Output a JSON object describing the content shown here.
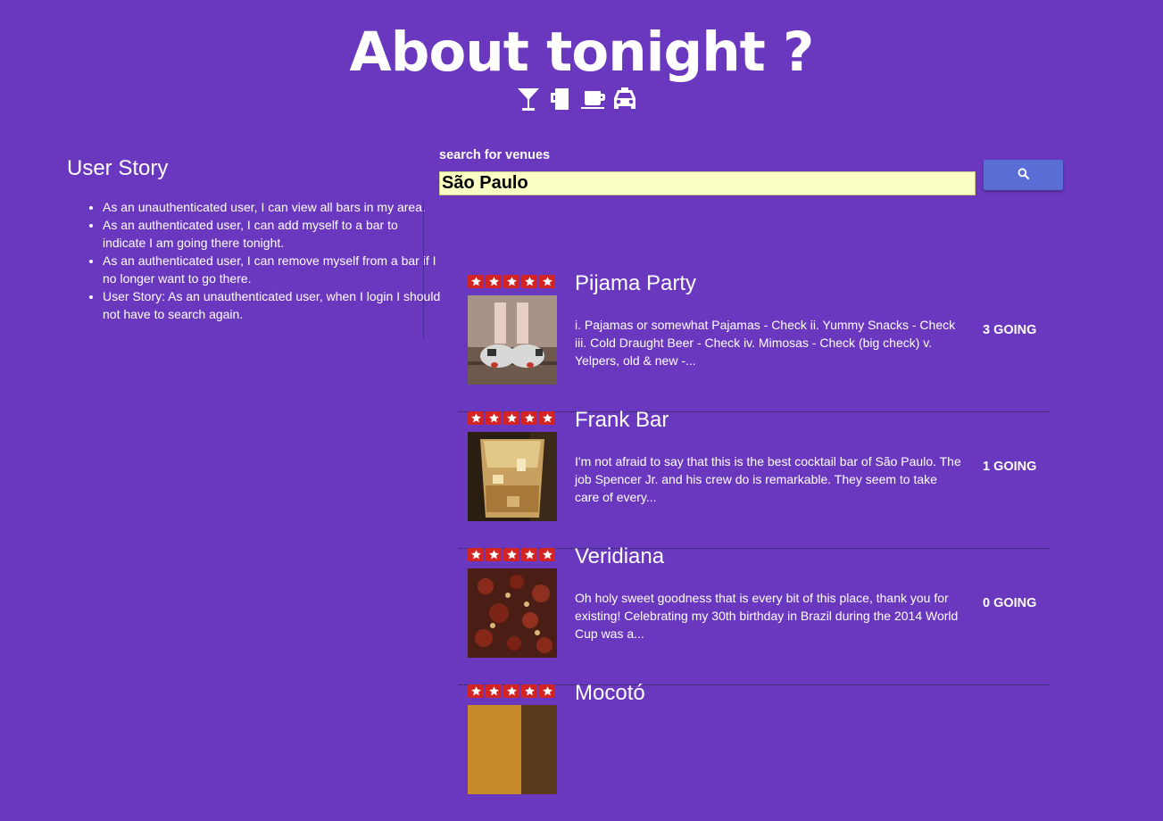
{
  "header": {
    "title": "About tonight ?",
    "icons": [
      "cocktail-icon",
      "beer-mug-icon",
      "coffee-cup-icon",
      "taxi-icon"
    ]
  },
  "user_story": {
    "title": "User Story",
    "items": [
      "As an unauthenticated user, I can view all bars in my area.",
      "As an authenticated user, I can add myself to a bar to indicate I am going there tonight.",
      "As an authenticated user, I can remove myself from a bar if I no longer want to go there.",
      "User Story: As an unauthenticated user, when I login I should not have to search again."
    ]
  },
  "search": {
    "label": "search for venues",
    "value": "São Paulo",
    "button_icon": "search-icon"
  },
  "venues": [
    {
      "name": "Pijama Party",
      "rating": 5,
      "description": "i. Pajamas or somewhat Pajamas - Check ii. Yummy Snacks - Check iii. Cold Draught Beer - Check iv. Mimosas - Check (big check) v. Yelpers, old & new -...",
      "going": "3 GOING"
    },
    {
      "name": "Frank Bar",
      "rating": 5,
      "description": "I'm not afraid to say that this is the best cocktail bar of São Paulo. The job Spencer Jr. and his crew do is remarkable. They seem to take care of every...",
      "going": "1 GOING"
    },
    {
      "name": "Veridiana",
      "rating": 5,
      "description": "Oh holy sweet goodness that is every bit of this place, thank you for existing! Celebrating my 30th birthday in Brazil during the 2014 World Cup was a...",
      "going": "0 GOING"
    },
    {
      "name": "Mocotó",
      "rating": 5,
      "description": "",
      "going": ""
    }
  ],
  "colors": {
    "background": "#6a37bf",
    "search_input_bg": "#fbffc4",
    "search_button": "#5a6ed6",
    "star_red": "#d32323"
  }
}
